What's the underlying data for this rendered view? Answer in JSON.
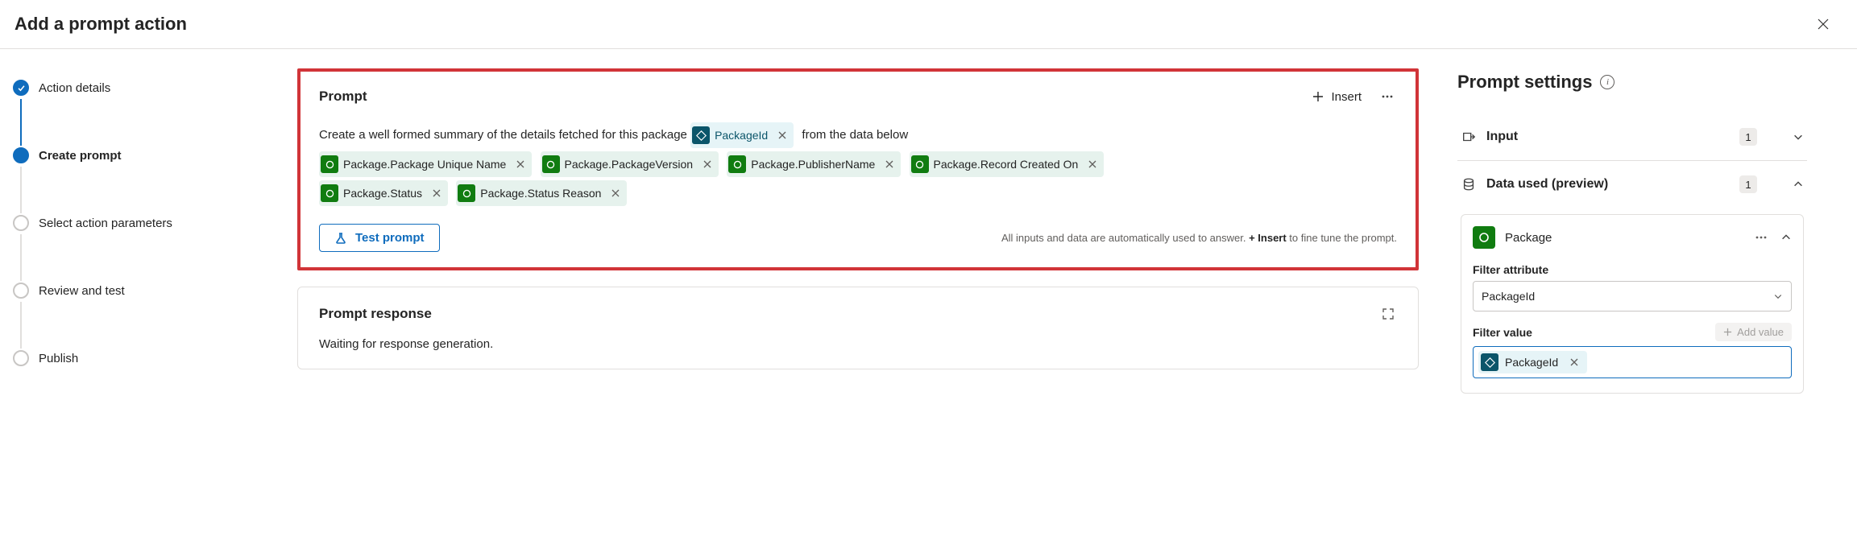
{
  "header": {
    "title": "Add a prompt action"
  },
  "stepper": {
    "steps": [
      {
        "label": "Action details",
        "state": "completed"
      },
      {
        "label": "Create prompt",
        "state": "active"
      },
      {
        "label": "Select action parameters",
        "state": "pending"
      },
      {
        "label": "Review and test",
        "state": "pending"
      },
      {
        "label": "Publish",
        "state": "pending"
      }
    ]
  },
  "prompt_card": {
    "title": "Prompt",
    "insert_label": "Insert",
    "text_before": "Create a well formed summary of the details fetched for this package",
    "text_after": "from the data below",
    "inline_token": "PackageId",
    "tokens": [
      "Package.Package Unique Name",
      "Package.PackageVersion",
      "Package.PublisherName",
      "Package.Record Created On",
      "Package.Status",
      "Package.Status Reason"
    ],
    "test_label": "Test prompt",
    "hint_prefix": "All inputs and data are automatically used to answer. ",
    "hint_bold": "+ Insert",
    "hint_suffix": " to fine tune the prompt."
  },
  "response_card": {
    "title": "Prompt response",
    "body": "Waiting for response generation."
  },
  "settings": {
    "title": "Prompt settings",
    "sections": {
      "input": {
        "title": "Input",
        "count": "1"
      },
      "data_used": {
        "title": "Data used (preview)",
        "count": "1"
      }
    },
    "package": {
      "name": "Package",
      "filter_attribute_label": "Filter attribute",
      "filter_attribute_value": "PackageId",
      "filter_value_label": "Filter value",
      "add_value_label": "Add value",
      "filter_value_chip": "PackageId"
    }
  }
}
